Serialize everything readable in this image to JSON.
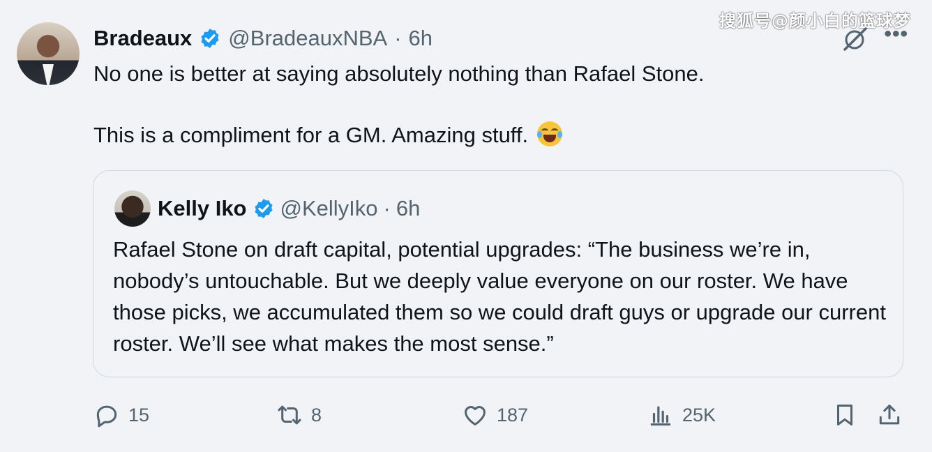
{
  "watermark": "搜狐号@颜小白的篮球梦",
  "tweet": {
    "author_name": "Bradeaux",
    "author_handle": "@BradeauxNBA",
    "separator": "·",
    "time": "6h",
    "text_line1": "No one is better at saying absolutely nothing than Rafael Stone.",
    "text_line2": "This is a compliment for a GM. Amazing stuff.",
    "emoji": "face-with-tears-of-joy-icon"
  },
  "quote": {
    "author_name": "Kelly Iko",
    "author_handle": "@KellyIko",
    "separator": "·",
    "time": "6h",
    "text": "Rafael Stone on draft capital, potential upgrades: “The business we’re in, nobody’s untouchable. But we deeply value everyone on our roster. We have those picks, we accumulated them so we could draft guys or upgrade our current roster. We’ll see what makes the most sense.”"
  },
  "actions": {
    "replies": "15",
    "reposts": "8",
    "likes": "187",
    "views": "25K"
  },
  "colors": {
    "background": "#f2f3f6",
    "text": "#0f1419",
    "secondary": "#536471",
    "verified": "#1d9bf0",
    "border": "#cfd9de"
  }
}
